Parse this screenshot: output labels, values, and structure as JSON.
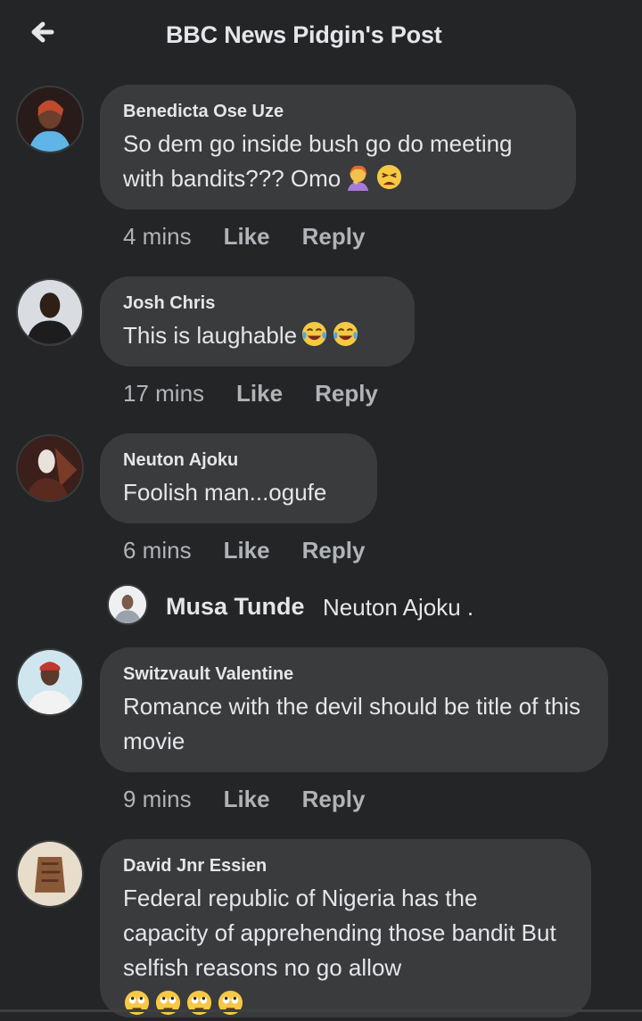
{
  "header": {
    "title": "BBC News Pidgin's Post",
    "back_icon": "arrow-left-icon"
  },
  "comments": [
    {
      "name": "Benedicta Ose Uze",
      "text": "So dem go inside bush go do meeting with bandits??? Omo",
      "emojis": [
        "person-facepalming-emoji",
        "tired-face-emoji"
      ],
      "time": "4 mins",
      "like": "Like",
      "reply": "Reply"
    },
    {
      "name": "Josh Chris",
      "text": "This is laughable",
      "emojis": [
        "face-with-tears-of-joy-emoji",
        "face-with-tears-of-joy-emoji"
      ],
      "time": "17 mins",
      "like": "Like",
      "reply": "Reply"
    },
    {
      "name": "Neuton Ajoku",
      "text": "Foolish man...ogufe",
      "time": "6 mins",
      "like": "Like",
      "reply": "Reply"
    },
    {
      "name": "Switzvault Valentine",
      "text": "Romance with the devil should be title of this movie",
      "time": "9 mins",
      "like": "Like",
      "reply": "Reply"
    },
    {
      "name": "David Jnr Essien",
      "text": "Federal republic of Nigeria  has the capacity of apprehending those bandit But selfish reasons no go allow",
      "emojis": [
        "face-with-rolling-eyes-emoji",
        "face-with-rolling-eyes-emoji",
        "face-with-rolling-eyes-emoji",
        "face-with-rolling-eyes-emoji"
      ]
    }
  ],
  "reply_preview": {
    "name": "Musa Tunde",
    "text": "Neuton Ajoku ."
  },
  "colors": {
    "background": "#242526",
    "bubble": "#3a3b3c",
    "text": "#e4e6eb",
    "secondary": "#b0b3b8"
  }
}
